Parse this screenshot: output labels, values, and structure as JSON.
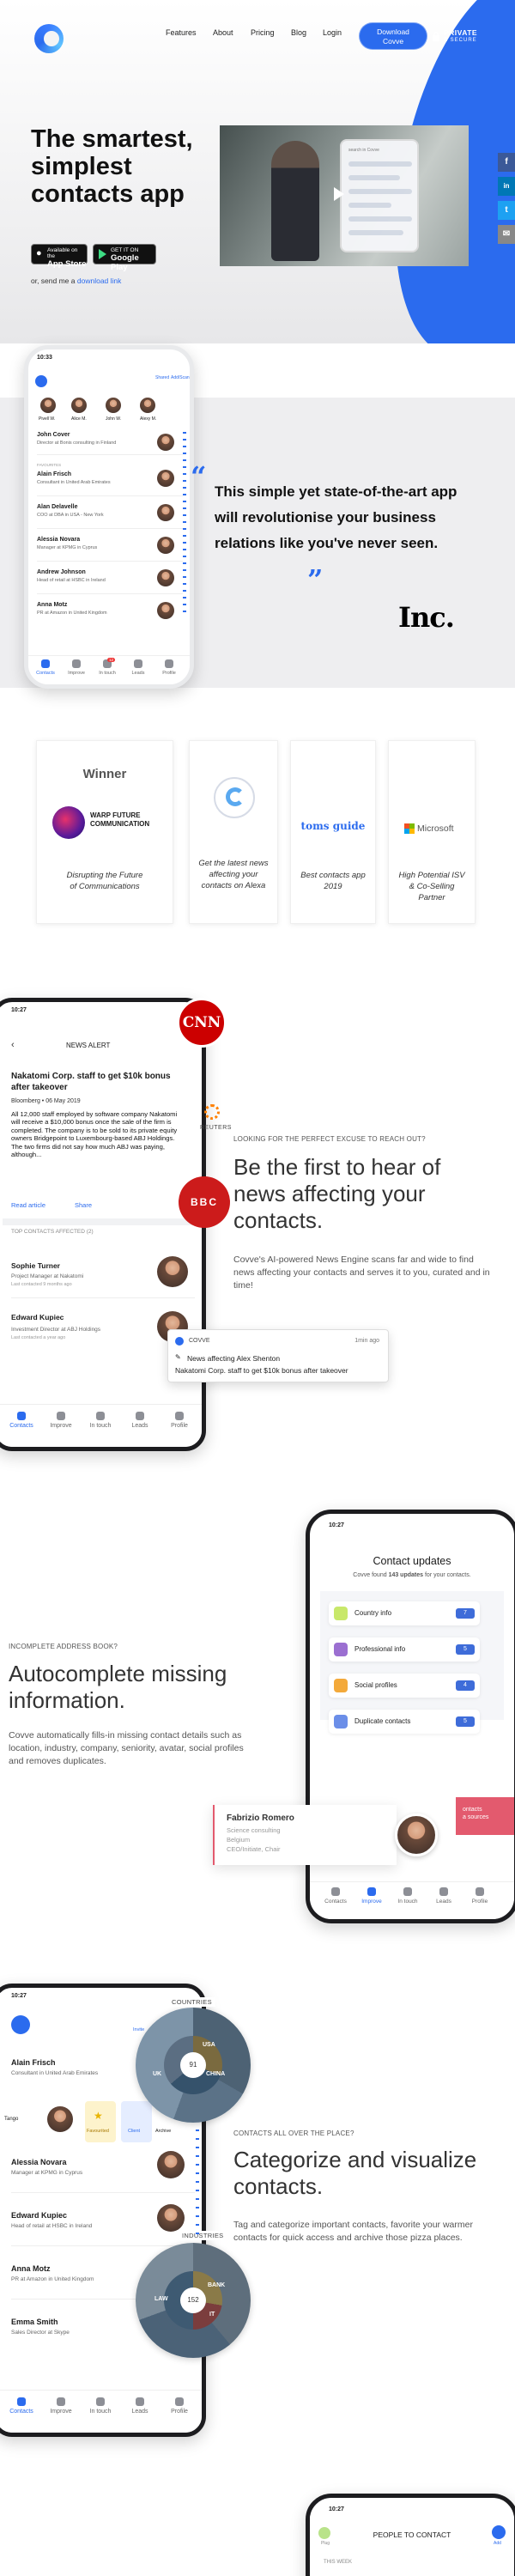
{
  "nav": {
    "features": "Features",
    "about": "About",
    "pricing": "Pricing",
    "blog": "Blog",
    "login": "Login",
    "download_line1": "Download",
    "download_line2": "Covve",
    "private_line1": "PRIVATE",
    "private_line2": "& SECURE"
  },
  "hero": {
    "title": "The smartest, simplest contacts app",
    "app_store_small": "Available on the",
    "app_store": "App Store",
    "google_play_small": "GET IT ON",
    "google_play": "Google Play",
    "send_prefix": "or, send me a",
    "send_link": "download link",
    "video_search": "search in Covve"
  },
  "social": [
    "f",
    "in",
    "t",
    "✉"
  ],
  "colors": {
    "brand_blue": "#2b6bee",
    "cnn_red": "#cc0000",
    "bbc_red": "#cc1b1b",
    "accent_pink": "#e35a6e"
  },
  "phone1": {
    "time": "10:33",
    "top_actions": [
      "Shared",
      "Add/Scan"
    ],
    "recent_names": [
      "Pivell W.",
      "Alice M.",
      "John W.",
      "Alexy M."
    ],
    "contacts": [
      {
        "name": "John Cover",
        "role": "Director at Bonis consulting in Finland"
      },
      {
        "name": "Alain Frisch",
        "role": "Consultant in United Arab Emirates"
      },
      {
        "name": "Alan Delavelle",
        "role": "COO at DBA in USA - New York"
      },
      {
        "name": "Alessia Novara",
        "role": "Manager at KPMG in Cyprus"
      },
      {
        "name": "Andrew Johnson",
        "role": "Head of retail at HSBC in Ireland"
      },
      {
        "name": "Anna Motz",
        "role": "PR at Amazon in United Kingdom"
      }
    ],
    "section_label": "FAVOURITES",
    "tabs": [
      "Contacts",
      "Improve",
      "In touch",
      "Leads",
      "Profile"
    ],
    "badge": "12"
  },
  "quote": {
    "text": "This simple yet state-of-the-art app will revolutionise your business relations like you've never seen.",
    "open_mark": "“",
    "close_mark": "”",
    "source": "Inc."
  },
  "awards": [
    {
      "head": "Winner",
      "logo_line1": "WARP FUTURE",
      "logo_line2": "COMMUNICATION",
      "caption": "Disrupting the Future of Communications"
    },
    {
      "caption": "Get the latest news affecting your contacts on Alexa"
    },
    {
      "logo": "toms guide",
      "caption": "Best contacts app 2019"
    },
    {
      "logo": "Microsoft",
      "caption": "High Potential ISV & Co-Selling Partner"
    }
  ],
  "news": {
    "phone": {
      "time": "10:27",
      "header": "NEWS ALERT",
      "headline": "Nakatomi Corp. staff to get $10k bonus after takeover",
      "source_date": "Bloomberg • 06 May 2019",
      "body": "All 12,000 staff employed by software company Nakatomi will receive a $10,000 bonus once the sale of the firm is completed. The company is to be sold to its private equity owners Bridgepoint to Luxembourg-based ABJ Holdings. The two firms did not say how much ABJ was paying, although...",
      "read_article": "Read article",
      "share": "Share",
      "affected_label": "TOP CONTACTS AFFECTED (2)",
      "contacts": [
        {
          "name": "Sophie Turner",
          "role": "Project Manager at Nakatomi",
          "last": "Last contacted 9 months ago"
        },
        {
          "name": "Edward Kupiec",
          "role": "Investment Director at ABJ Holdings",
          "last": "Last contacted a year ago"
        }
      ],
      "tabs": [
        "Contacts",
        "Improve",
        "In touch",
        "Leads",
        "Profile"
      ]
    },
    "brands": {
      "cnn": "CNN",
      "reuters": "REUTERS",
      "bbc": "BBC"
    },
    "eyebrow": "LOOKING FOR THE PERFECT EXCUSE TO REACH OUT?",
    "heading": "Be the first to hear of news affecting your contacts.",
    "body": "Covve's AI-powered News Engine scans far and wide to find news affecting your contacts and serves it to you, curated and in time!",
    "toast": {
      "app": "COVVE",
      "time": "1min ago",
      "line1": "News affecting Alex Shenton",
      "line2": "Nakatomi Corp. staff to get $10k bonus after takeover"
    }
  },
  "autocomplete": {
    "eyebrow": "INCOMPLETE ADDRESS BOOK?",
    "heading": "Autocomplete missing information.",
    "body": "Covve automatically fills-in missing contact details such as location, industry, company, seniority, avatar, social profiles and removes duplicates.",
    "phone": {
      "time": "10:27",
      "title": "Contact updates",
      "subtitle_prefix": "Covve found",
      "subtitle_count": "143 updates",
      "subtitle_suffix": "for your contacts.",
      "rows": [
        {
          "label": "Country info",
          "count": "7"
        },
        {
          "label": "Professional info",
          "count": "5"
        },
        {
          "label": "Social profiles",
          "count": "4"
        },
        {
          "label": "Duplicate contacts",
          "count": "5"
        }
      ],
      "tabs": [
        "Contacts",
        "Improve",
        "In touch",
        "Leads",
        "Profile"
      ]
    },
    "card": {
      "name": "Fabrizio Romero",
      "line1": "Science consulting",
      "line2": "Belgium",
      "line3": "CEO/Initiate, Chair",
      "side1": "ontacts",
      "side2": "a sources"
    }
  },
  "categorize": {
    "eyebrow": "CONTACTS ALL OVER THE PLACE?",
    "heading": "Categorize and visualize contacts.",
    "body": "Tag and categorize important contacts, favorite your warmer contacts for quick access and archive those pizza places.",
    "phone": {
      "time": "10:27",
      "top_action": "Invite",
      "contacts": [
        {
          "name": "Alain Frisch",
          "role": "Consultant in United Arab Emirates"
        },
        {
          "name": "Alessia Novara",
          "role": "Manager at KPMG in Cyprus"
        },
        {
          "name": "Edward Kupiec",
          "role": "Head of retail at HSBC in Ireland"
        },
        {
          "name": "Anna Motz",
          "role": "PR at Amazon in United Kingdom"
        },
        {
          "name": "Emma Smith",
          "role": "Sales Director at Skype"
        }
      ],
      "chips": [
        "Tango",
        "Favourited",
        "Client",
        "Archive"
      ],
      "tabs": [
        "Contacts",
        "Improve",
        "In touch",
        "Leads",
        "Profile"
      ]
    },
    "wheel1": {
      "head": "COUNTRIES",
      "center": "91",
      "segments": [
        "USA",
        "UK",
        "CHINA"
      ]
    },
    "wheel2": {
      "head": "INDUSTRIES",
      "center": "152",
      "segments": [
        "BANK",
        "LAW",
        "IT"
      ]
    }
  },
  "last_phone": {
    "time": "10:27",
    "title": "PEOPLE TO CONTACT",
    "section": "THIS WEEK",
    "tab_left": "Plug",
    "tab_right": "Add"
  }
}
